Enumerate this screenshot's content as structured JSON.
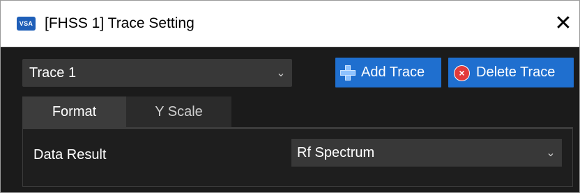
{
  "window": {
    "app_badge": "VSA",
    "title": "[FHSS 1] Trace Setting",
    "close_glyph": "✕"
  },
  "trace_select": {
    "value": "Trace 1",
    "chevron_icon": "chevron-down-icon"
  },
  "buttons": {
    "add_trace": {
      "label": "Add Trace",
      "icon": "plus-icon"
    },
    "delete_trace": {
      "label": "Delete Trace",
      "icon": "delete-circle-icon"
    }
  },
  "tabs": [
    {
      "label": "Format",
      "selected": true
    },
    {
      "label": "Y Scale",
      "selected": false
    }
  ],
  "format_panel": {
    "data_result_label": "Data Result",
    "data_result_value": "Rf Spectrum"
  },
  "colors": {
    "accent_button": "#1f6fcf",
    "delete_icon": "#e23b3b",
    "dark_bg": "#1b1b1b",
    "control_bg": "#383838"
  }
}
